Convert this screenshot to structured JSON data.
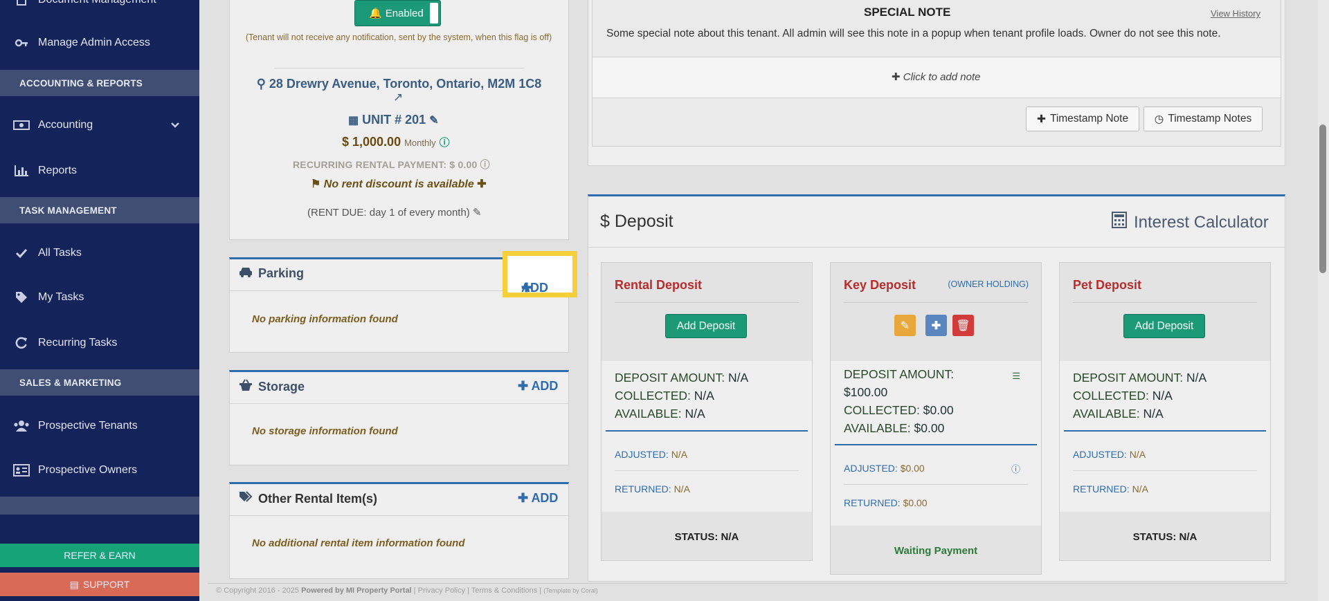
{
  "sidebar": {
    "items": [
      {
        "label": "Document Management",
        "icon": "document-icon"
      },
      {
        "label": "Manage Admin Access",
        "icon": "key-icon"
      },
      {
        "label": "Accounting",
        "icon": "money-icon"
      },
      {
        "label": "Reports",
        "icon": "bar-chart-icon"
      },
      {
        "label": "All Tasks",
        "icon": "check-icon"
      },
      {
        "label": "My Tasks",
        "icon": "tag-icon"
      },
      {
        "label": "Recurring Tasks",
        "icon": "refresh-icon"
      },
      {
        "label": "Prospective Tenants",
        "icon": "users-icon"
      },
      {
        "label": "Prospective Owners",
        "icon": "id-card-icon"
      }
    ],
    "sections": [
      "ACCOUNTING & REPORTS",
      "TASK MANAGEMENT",
      "SALES & MARKETING"
    ],
    "refer_label": "REFER & EARN",
    "support_label": "SUPPORT"
  },
  "tenant": {
    "enabled_label": "Enabled",
    "notification_note": "(Tenant will not receive any notification, sent by the system, when this flag is off)",
    "address": "28 Drewry Avenue, Toronto, Ontario, M2M 1C8",
    "unit": "UNIT # 201",
    "rent_amount": "$ 1,000.00",
    "rent_period": "Monthly",
    "recurring": "RECURRING RENTAL PAYMENT: $ 0.00",
    "discount": "No rent discount is available",
    "rent_due": "(RENT DUE: day 1 of every month)"
  },
  "parking": {
    "title": "Parking",
    "add": "ADD",
    "empty": "No parking information found"
  },
  "storage": {
    "title": "Storage",
    "add": "ADD",
    "empty": "No storage information found"
  },
  "other": {
    "title": "Other Rental Item(s)",
    "add": "ADD",
    "empty": "No additional rental item information found"
  },
  "special_note": {
    "title": "SPECIAL NOTE",
    "view_history": "View History",
    "text": "Some special note about this tenant. All admin will see this note in a popup when tenant profile loads. Owner do not see this note.",
    "click_add": "Click to add note",
    "timestamp_note": "Timestamp Note",
    "timestamp_notes": "Timestamp Notes"
  },
  "deposit": {
    "title": "Deposit",
    "interest": "Interest Calculator",
    "cards": [
      {
        "name": "Rental Deposit",
        "button": "Add Deposit",
        "amount_label": "DEPOSIT AMOUNT:",
        "amount": "N/A",
        "collected_label": "COLLECTED:",
        "collected": "N/A",
        "available_label": "AVAILABLE:",
        "available": "N/A",
        "adjusted_label": "ADJUSTED:",
        "adjusted": "N/A",
        "returned_label": "RETURNED:",
        "returned": "N/A",
        "status": "STATUS: N/A"
      },
      {
        "name": "Key Deposit",
        "owner": "(OWNER HOLDING)",
        "amount_label": "DEPOSIT AMOUNT:",
        "amount": "$100.00",
        "collected_label": "COLLECTED:",
        "collected": "$0.00",
        "available_label": "AVAILABLE:",
        "available": "$0.00",
        "adjusted_label": "ADJUSTED:",
        "adjusted": "$0.00",
        "returned_label": "RETURNED:",
        "returned": "$0.00",
        "status": "Waiting Payment"
      },
      {
        "name": "Pet Deposit",
        "button": "Add Deposit",
        "amount_label": "DEPOSIT AMOUNT:",
        "amount": "N/A",
        "collected_label": "COLLECTED:",
        "collected": "N/A",
        "available_label": "AVAILABLE:",
        "available": "N/A",
        "adjusted_label": "ADJUSTED:",
        "adjusted": "N/A",
        "returned_label": "RETURNED:",
        "returned": "N/A",
        "status": "STATUS: N/A"
      }
    ]
  },
  "footer": {
    "copyright": "© Copyright 2016 - 2025",
    "powered": "Powered by MI Property Portal",
    "privacy": "Privacy Policy",
    "terms": "Terms & Conditions",
    "template": "(Template by Coral)"
  },
  "colors": {
    "sidebar": "#14235a",
    "accent_green": "#1c9a78",
    "link_blue": "#2f6cae",
    "highlight": "#f7cf3a",
    "deposit_red": "#b52d2d"
  }
}
